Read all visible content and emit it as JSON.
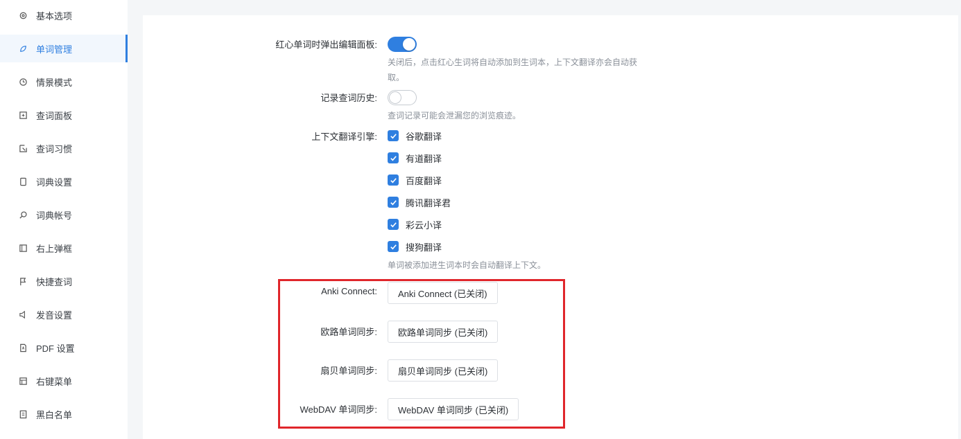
{
  "sidebar": {
    "items": [
      {
        "label": "基本选项",
        "icon": "gear-icon"
      },
      {
        "label": "单词管理",
        "icon": "leaf-icon",
        "active": true
      },
      {
        "label": "情景模式",
        "icon": "clock-icon"
      },
      {
        "label": "查词面板",
        "icon": "panel-icon"
      },
      {
        "label": "查词习惯",
        "icon": "cursor-icon"
      },
      {
        "label": "词典设置",
        "icon": "book-icon"
      },
      {
        "label": "词典帐号",
        "icon": "search-icon"
      },
      {
        "label": "右上弹框",
        "icon": "window-icon"
      },
      {
        "label": "快捷查词",
        "icon": "flag-icon"
      },
      {
        "label": "发音设置",
        "icon": "speaker-icon"
      },
      {
        "label": "PDF 设置",
        "icon": "pdf-icon"
      },
      {
        "label": "右键菜单",
        "icon": "menu-icon"
      },
      {
        "label": "黑白名单",
        "icon": "list-icon"
      }
    ]
  },
  "settings": {
    "red_heart_editor": {
      "label": "红心单词时弹出编辑面板:",
      "enabled": true,
      "hint_line1": "关闭后，点击红心生词将自动添加到生词本，上下文翻译亦会自动获",
      "hint_line2": "取。"
    },
    "history": {
      "label": "记录查词历史:",
      "enabled": false,
      "hint": "查词记录可能会泄漏您的浏览痕迹。"
    },
    "context_engines": {
      "label": "上下文翻译引擎:",
      "options": [
        {
          "label": "谷歌翻译",
          "checked": true
        },
        {
          "label": "有道翻译",
          "checked": true
        },
        {
          "label": "百度翻译",
          "checked": true
        },
        {
          "label": "腾讯翻译君",
          "checked": true
        },
        {
          "label": "彩云小译",
          "checked": true
        },
        {
          "label": "搜狗翻译",
          "checked": true
        }
      ],
      "hint": "单词被添加进生词本时会自动翻译上下文。"
    },
    "sync": [
      {
        "label": "Anki Connect:",
        "button": "Anki Connect (已关闭)"
      },
      {
        "label": "欧路单词同步:",
        "button": "欧路单词同步 (已关闭)"
      },
      {
        "label": "扇贝单词同步:",
        "button": "扇贝单词同步 (已关闭)"
      },
      {
        "label": "WebDAV 单词同步:",
        "button": "WebDAV 单词同步 (已关闭)"
      }
    ]
  },
  "colors": {
    "accent": "#2f7fe0",
    "highlight": "#e0262b"
  }
}
